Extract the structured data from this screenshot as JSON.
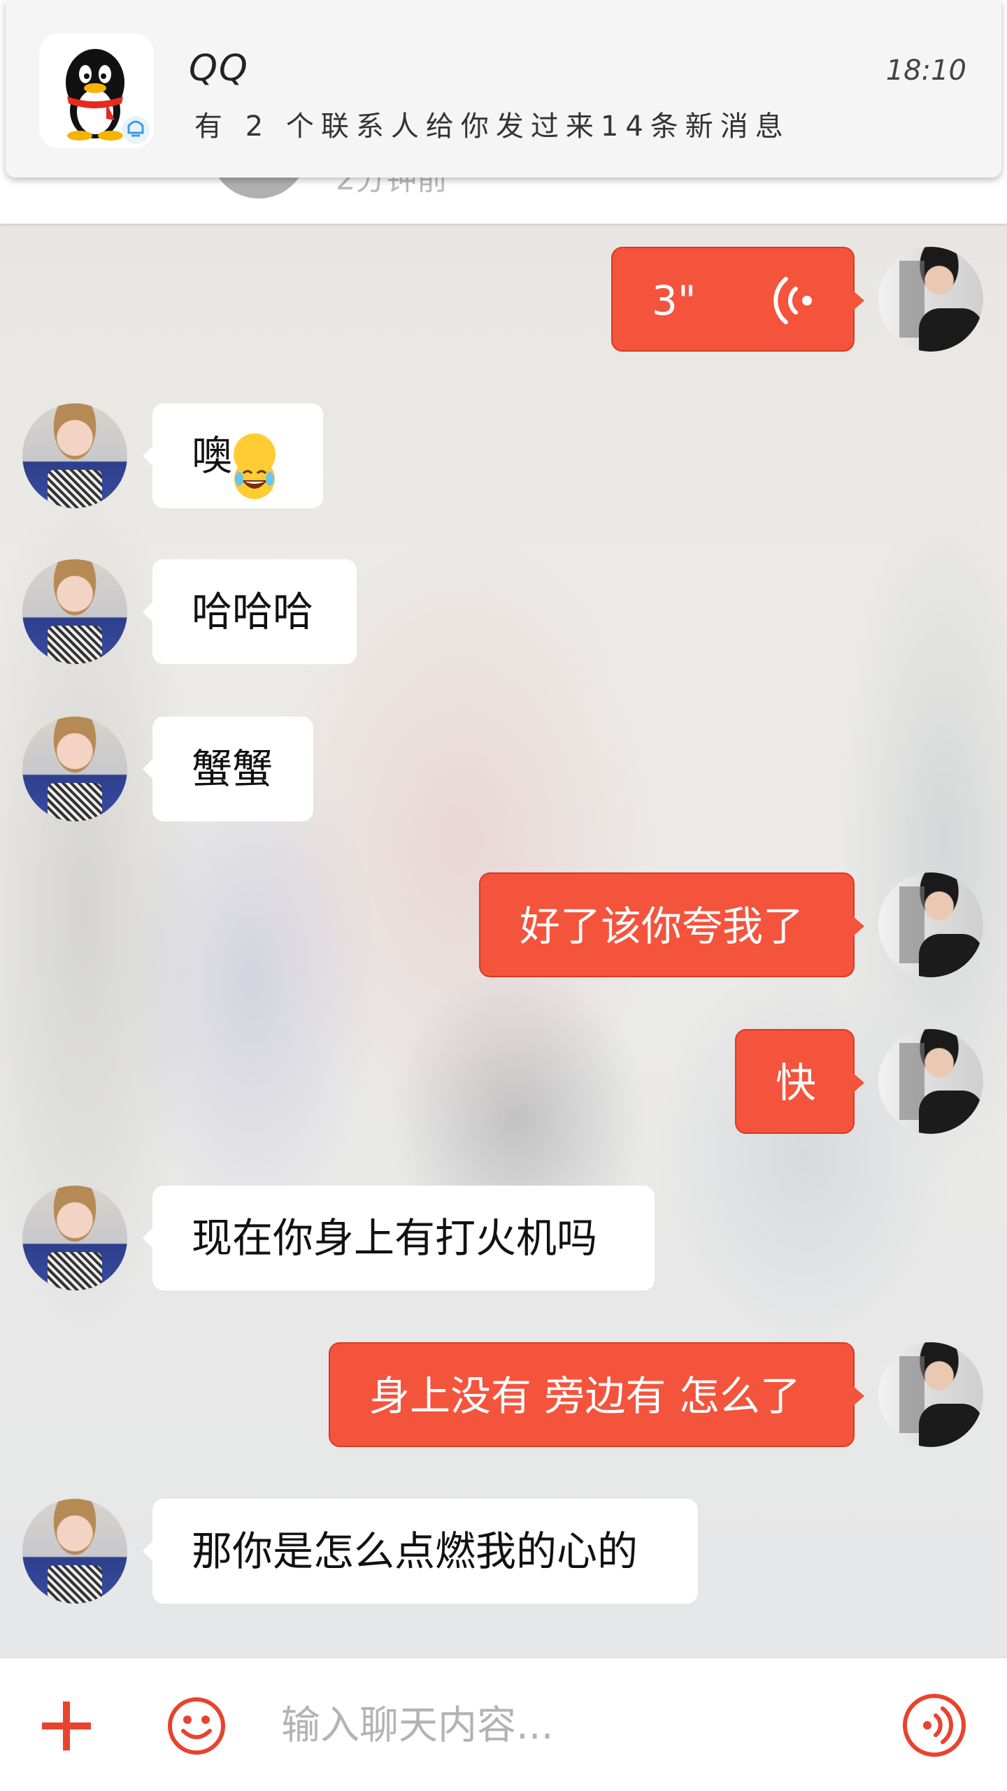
{
  "notification": {
    "app_name": "QQ",
    "time": "18:10",
    "body": "有 2 个联系人给你发过来14条新消息"
  },
  "header": {
    "status_text": "2分钟前"
  },
  "messages": [
    {
      "side": "out",
      "type": "voice",
      "duration": "3\""
    },
    {
      "side": "in",
      "text": "噢",
      "emoji": "laughing-tears-emoji"
    },
    {
      "side": "in",
      "text": "哈哈哈"
    },
    {
      "side": "in",
      "text": "蟹蟹"
    },
    {
      "side": "out",
      "text": "好了该你夸我了"
    },
    {
      "side": "out",
      "text": "快"
    },
    {
      "side": "in",
      "text": "现在你身上有打火机吗"
    },
    {
      "side": "out",
      "text": "身上没有 旁边有 怎么了"
    },
    {
      "side": "in",
      "text": "那你是怎么点燃我的心的"
    }
  ],
  "composer": {
    "placeholder": "输入聊天内容..."
  },
  "colors": {
    "outgoing_bubble": "#f4533c",
    "incoming_bubble": "#ffffff",
    "accent": "#e8432f"
  }
}
